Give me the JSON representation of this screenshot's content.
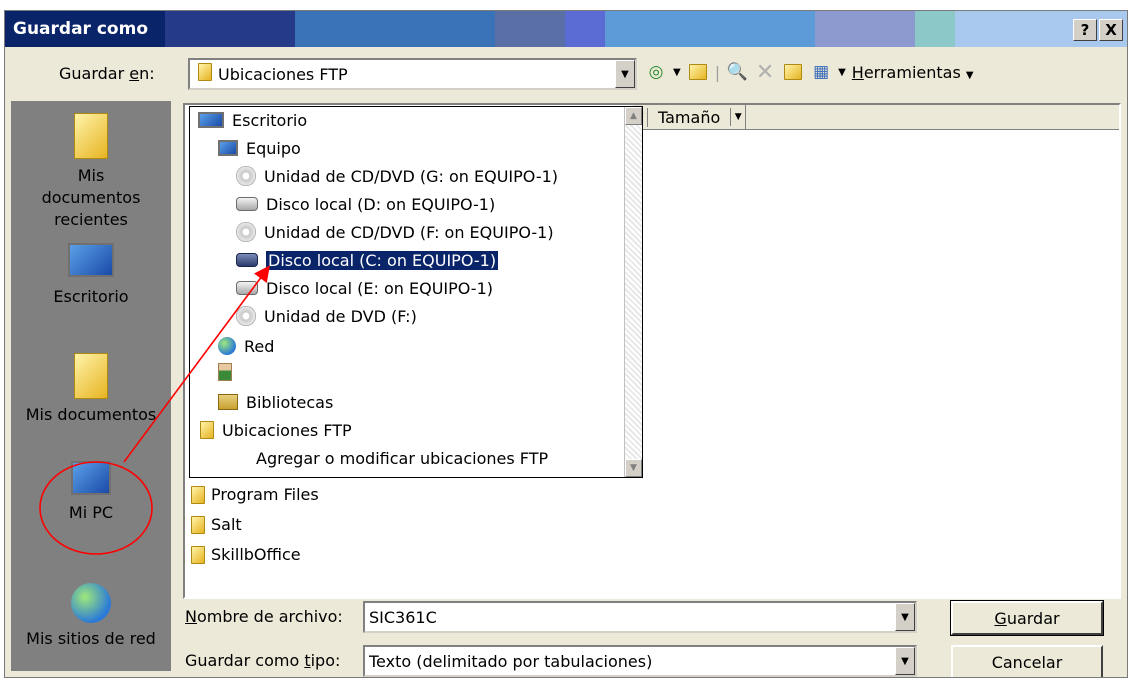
{
  "window": {
    "title": "Guardar como",
    "help_btn": "?",
    "close_btn": "X"
  },
  "save_in": {
    "label_pre": "Guardar ",
    "label_u": "e",
    "label_post": "n:",
    "value": "Ubicaciones FTP"
  },
  "toolbar": {
    "tools_u": "H",
    "tools_rest": "erramientas"
  },
  "places": [
    {
      "label": "Mis documentos recientes"
    },
    {
      "label": "Escritorio"
    },
    {
      "label": "Mis documentos"
    },
    {
      "label": "Mi PC"
    },
    {
      "label": "Mis sitios de red"
    }
  ],
  "columns": {
    "size": "Tamaño"
  },
  "files": [
    "Program Files",
    "Salt",
    "SkillbOffice"
  ],
  "dropdown": {
    "items": [
      {
        "label": "Escritorio"
      },
      {
        "label": "Equipo"
      },
      {
        "label": "Unidad de CD/DVD (G: on EQUIPO-1)"
      },
      {
        "label": "Disco local (D: on EQUIPO-1)"
      },
      {
        "label": "Unidad de CD/DVD (F: on EQUIPO-1)"
      },
      {
        "label": "Disco local (C: on EQUIPO-1)"
      },
      {
        "label": "Disco local (E: on EQUIPO-1)"
      },
      {
        "label": "Unidad de DVD (F:)"
      },
      {
        "label": "Red"
      },
      {
        "label": ""
      },
      {
        "label": "Bibliotecas"
      },
      {
        "label": "Ubicaciones FTP"
      },
      {
        "label": "Agregar o modificar ubicaciones FTP"
      }
    ],
    "selected": "Disco local (C: on EQUIPO-1)"
  },
  "filename": {
    "label_u": "N",
    "label_rest": "ombre de archivo:",
    "value": "SIC361C"
  },
  "filetype": {
    "label_pre": "Guardar como ",
    "label_u": "t",
    "label_post": "ipo:",
    "value": "Texto (delimitado por tabulaciones)"
  },
  "buttons": {
    "save_u": "G",
    "save_rest": "uardar",
    "cancel": "Cancelar"
  },
  "colors": {
    "title_bar": "#0a246a",
    "selection": "#0a246a",
    "annotation": "#ff0000"
  }
}
